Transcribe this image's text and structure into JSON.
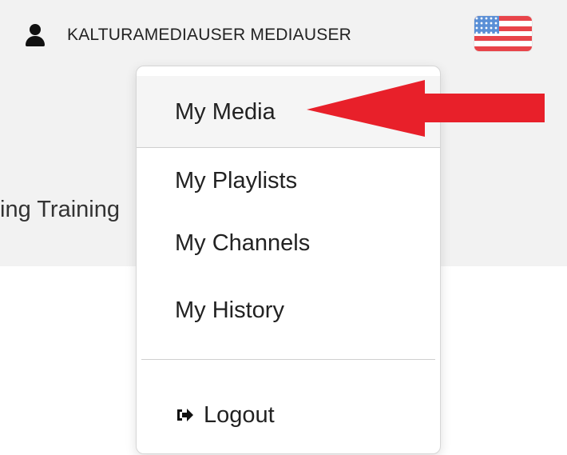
{
  "header": {
    "user_name": "KALTURAMEDIAUSER MEDIAUSER",
    "user_icon": "user-icon",
    "flag_icon": "us-flag-icon"
  },
  "page": {
    "title_fragment": "ting Training"
  },
  "dropdown": {
    "items": [
      {
        "label": "My Media"
      },
      {
        "label": "My Playlists"
      },
      {
        "label": "My Channels"
      },
      {
        "label": "My History"
      }
    ],
    "logout_label": "Logout",
    "logout_icon": "sign-out-icon"
  },
  "annotation": {
    "arrow_color": "#e8202a",
    "arrow_icon": "red-arrow-pointer"
  }
}
